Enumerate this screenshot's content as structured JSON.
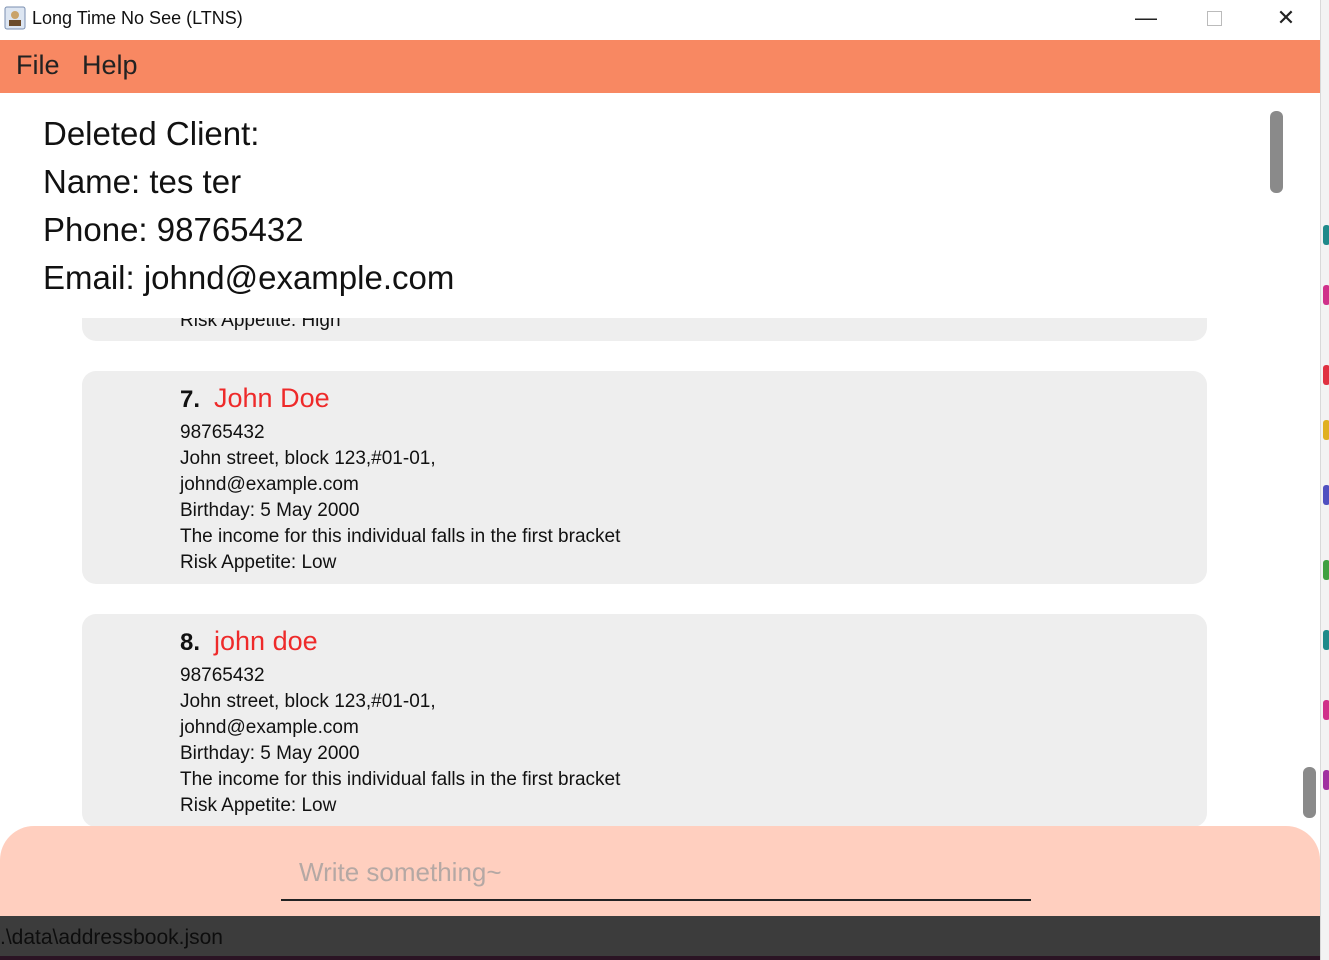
{
  "window": {
    "title": "Long Time No See (LTNS)",
    "minimize_glyph": "—",
    "close_glyph": "✕"
  },
  "menu": {
    "file_label": "File",
    "help_label": "Help"
  },
  "result": {
    "lines": [
      "Deleted Client:",
      "Name: tes ter",
      "Phone: 98765432",
      "Email: johnd@example.com"
    ]
  },
  "list": {
    "previous_card_last_line": "Risk Appetite: High",
    "cards": [
      {
        "index": "7.",
        "name": "John Doe",
        "phone": "98765432",
        "address": "John street, block 123,#01-01,",
        "email": "johnd@example.com",
        "birthday": "Birthday: 5 May 2000",
        "income": "The income for this individual falls in the first bracket",
        "risk": "Risk Appetite: Low"
      },
      {
        "index": "8.",
        "name": "john doe",
        "phone": "98765432",
        "address": "John street, block 123,#01-01,",
        "email": "johnd@example.com",
        "birthday": "Birthday: 5 May 2000",
        "income": "The income for this individual falls in the first bracket",
        "risk": "Risk Appetite: Low"
      }
    ]
  },
  "command": {
    "placeholder": "Write something~",
    "value": ""
  },
  "status": {
    "path": ".\\data\\addressbook.json"
  },
  "colors": {
    "menubar": "#f88862",
    "command_box": "#ffcfbf",
    "name_red": "#ee2a2a",
    "card_bg": "#eeeeee",
    "statusbar": "#3c3c3c"
  }
}
